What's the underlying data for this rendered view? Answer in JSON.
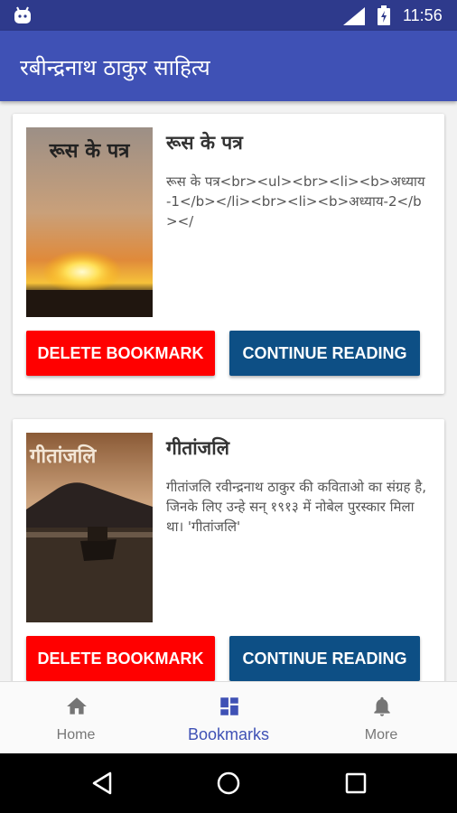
{
  "status": {
    "time": "11:56"
  },
  "app": {
    "title": "रबीन्द्रनाथ ठाकुर साहित्य"
  },
  "books": [
    {
      "cover_title": "रूस के पत्र",
      "title": "रूस के पत्र",
      "description": "रूस के पत्र<br><ul><br><li><b>अध्याय-1</b></li><br><li><b>अध्याय-2</b></",
      "delete_label": "DELETE BOOKMARK",
      "continue_label": "CONTINUE READING"
    },
    {
      "cover_title": "गीतांजलि",
      "title": "गीतांजलि",
      "description": "गीतांजलि रवीन्द्रनाथ ठाकुर की कविताओ का संग्रह है, जिनके लिए उन्हे सन् १९१३ में नोबेल पुरस्कार मिला था। 'गीतांजलि'",
      "delete_label": "DELETE BOOKMARK",
      "continue_label": "CONTINUE READING"
    }
  ],
  "nav": {
    "items": [
      {
        "label": "Home",
        "icon": "home-icon"
      },
      {
        "label": "Bookmarks",
        "icon": "dashboard-icon",
        "active": true
      },
      {
        "label": "More",
        "icon": "bell-icon"
      }
    ]
  },
  "colors": {
    "primary": "#3f51b5",
    "status_bar": "#2e3a8c",
    "delete": "#ff0000",
    "continue": "#0d4f85"
  }
}
